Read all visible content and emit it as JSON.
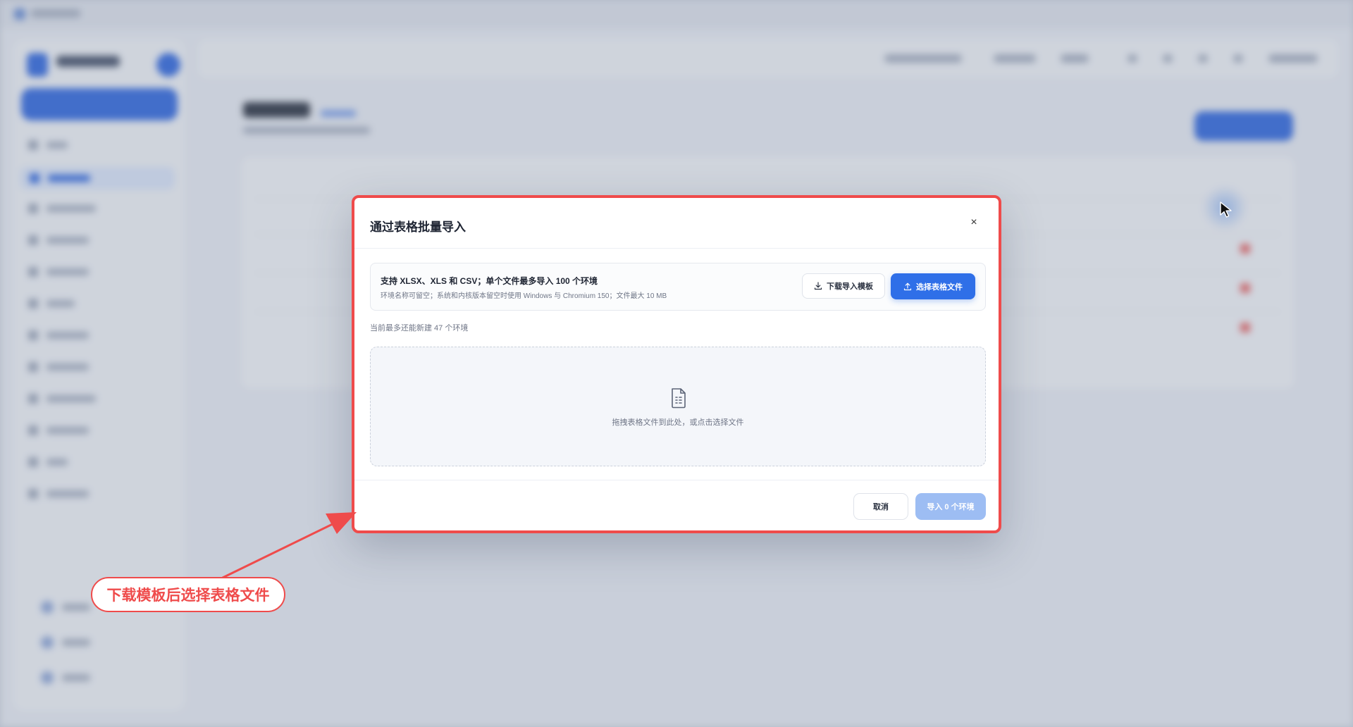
{
  "modal": {
    "title": "通过表格批量导入",
    "close_glyph": "×",
    "info": {
      "title": "支持 XLSX、XLS 和 CSV；单个文件最多导入 100 个环境",
      "subtitle": "环境名称可留空；系统和内核版本留空时使用 Windows 与 Chromium 150；文件最大 10 MB"
    },
    "download_template_label": "下载导入模板",
    "select_file_label": "选择表格文件",
    "remaining_text": "当前最多还能新建 47 个环境",
    "dropzone_text": "拖拽表格文件到此处，或点击选择文件",
    "cancel_label": "取消",
    "import_label": "导入 0 个环境"
  },
  "annotation": {
    "callout_text": "下载模板后选择表格文件"
  },
  "colors": {
    "accent": "#2f6fe8",
    "annotation_red": "#ef4b4b",
    "import_disabled": "#9dbdf3"
  },
  "icons": {
    "download": "download-icon",
    "upload": "upload-icon",
    "file": "spreadsheet-file-icon",
    "close": "close-icon",
    "cursor": "mouse-cursor"
  }
}
